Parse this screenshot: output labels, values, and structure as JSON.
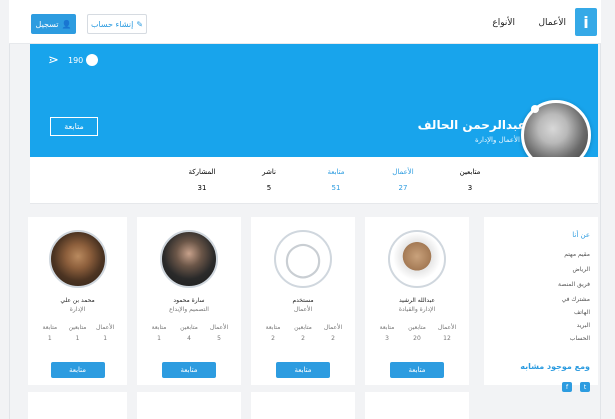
{
  "header": {
    "logo": "i",
    "nav": [
      "الأعمال",
      "الأنواع"
    ],
    "login": "تسجيل",
    "register": "إنشاء حساب"
  },
  "profile": {
    "name": "عبدالرحمن الحالف",
    "job": "الأعمال والإدارة",
    "follow": "متابعة",
    "views": "190",
    "stats": [
      {
        "label": "متابعين",
        "value": "3"
      },
      {
        "label": "الأعمال",
        "value": "27"
      },
      {
        "label": "متابعة",
        "value": "51"
      },
      {
        "label": "ناشر",
        "value": "5"
      },
      {
        "label": "المشاركة",
        "value": "31"
      }
    ]
  },
  "sidebar": {
    "title": "عن أنا",
    "lines": [
      "مقيم مهتم",
      "الرياض",
      "فريق المنصة",
      "مشترك في",
      "الهاتف",
      "البريد",
      "الحساب"
    ],
    "more": "ومع موجود مشابه",
    "social": [
      "twitter",
      "facebook"
    ]
  },
  "cards": [
    {
      "name": "عبدالله الرشيد",
      "job": "الإدارة والقيادة",
      "stats": [
        {
          "l": "الأعمال",
          "n": "12"
        },
        {
          "l": "متابعين",
          "n": "20"
        },
        {
          "l": "متابعة",
          "n": "3"
        }
      ],
      "button": "متابعة"
    },
    {
      "name": "مستخدم",
      "job": "الأعمال",
      "stats": [
        {
          "l": "الأعمال",
          "n": "2"
        },
        {
          "l": "متابعين",
          "n": "2"
        },
        {
          "l": "متابعة",
          "n": "2"
        }
      ],
      "button": "متابعة"
    },
    {
      "name": "سارة محمود",
      "job": "التصميم والإبداع",
      "stats": [
        {
          "l": "الأعمال",
          "n": "5"
        },
        {
          "l": "متابعين",
          "n": "4"
        },
        {
          "l": "متابعة",
          "n": "1"
        }
      ],
      "button": "متابعة"
    },
    {
      "name": "محمد بن علي",
      "job": "الإدارة",
      "stats": [
        {
          "l": "الأعمال",
          "n": "1"
        },
        {
          "l": "متابعين",
          "n": "1"
        },
        {
          "l": "متابعة",
          "n": "1"
        }
      ],
      "button": "متابعة"
    }
  ],
  "colors": {
    "accent": "#2d9ce0",
    "banner": "#18a4ec"
  }
}
